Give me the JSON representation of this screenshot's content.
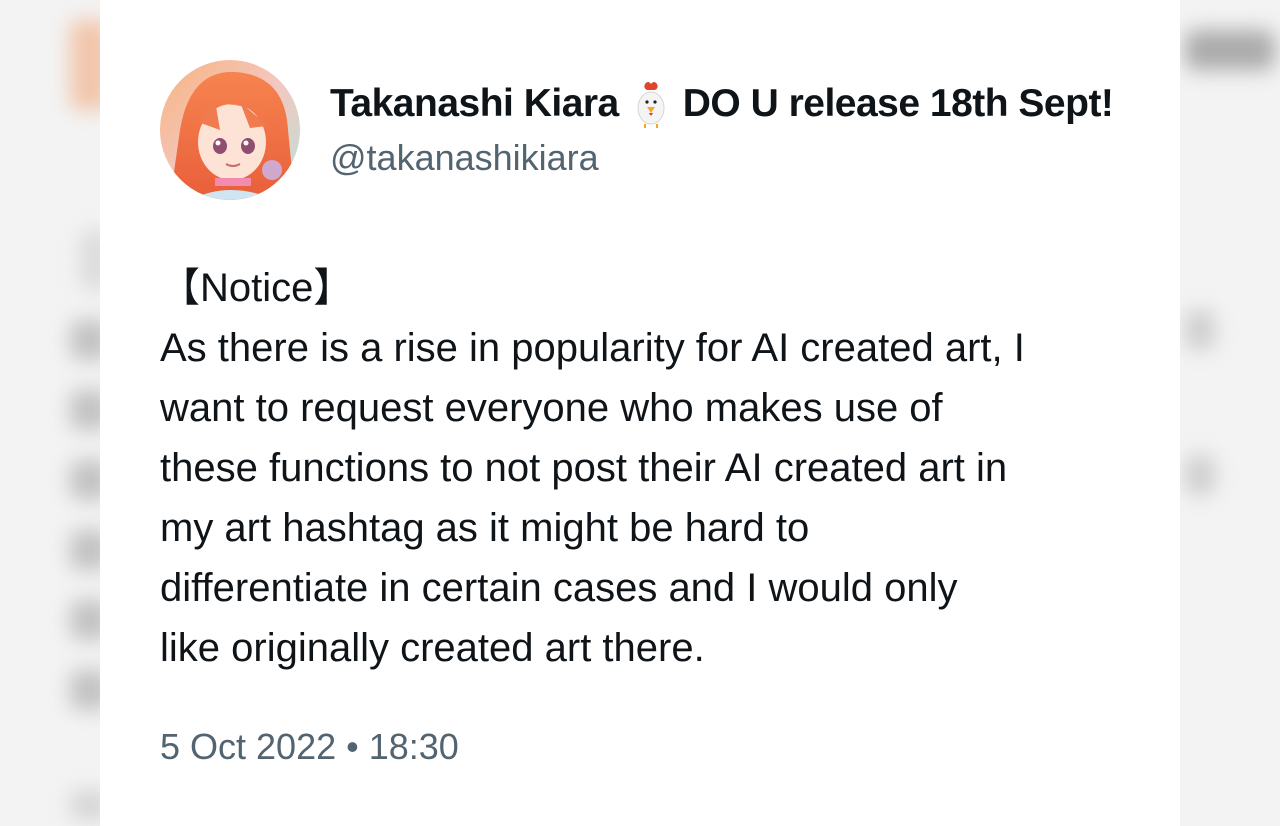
{
  "tweet": {
    "display_name_part1": "Takanashi Kiara",
    "display_name_part2": "DO U release 18th Sept!",
    "handle": "@takanashikiara",
    "text_lines": [
      "【Notice】",
      "As there is a rise in popularity for AI created art, I",
      "want to request everyone who makes use of",
      "these functions to not post their AI created art in",
      "my art hashtag as it might be hard to",
      "differentiate in certain cases and I would only",
      "like originally created art there."
    ],
    "timestamp": "5 Oct 2022 • 18:30",
    "name_emoji_icon": "rooster-icon",
    "avatar_icon": "profile-avatar"
  },
  "colors": {
    "text_primary": "#0f1419",
    "text_secondary": "#536471",
    "background": "#ffffff",
    "avatar_hair": "#f07b4f"
  }
}
